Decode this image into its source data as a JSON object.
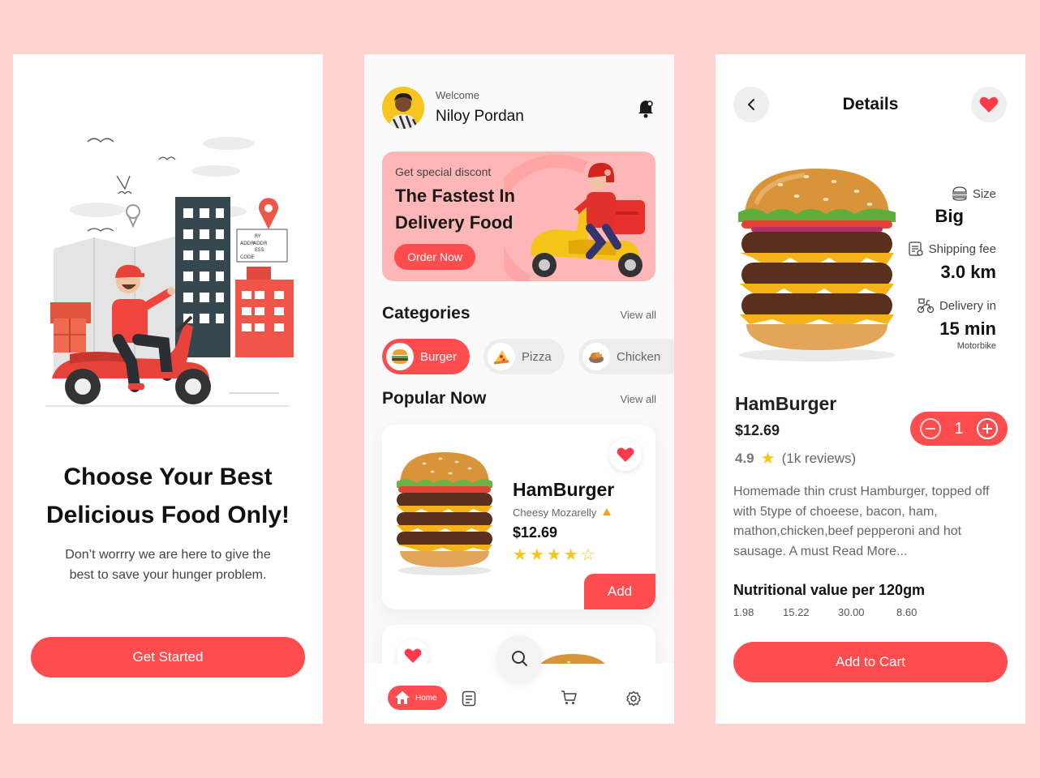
{
  "colors": {
    "background": "#FFD2D2",
    "accent": "#FF4D4F",
    "star": "#F8C51C",
    "promo": "#FFB6B6"
  },
  "onboarding": {
    "title_line1": "Choose Your Best",
    "title_line2": "Delicious Food Only!",
    "description": "Don’t worrry we are here to give the best to save your hunger problem.",
    "cta": "Get Started",
    "illustration_sign": [
      "RY",
      "ADDR",
      "ADDR",
      "ESS",
      "CODE"
    ]
  },
  "home": {
    "welcome": "Welcome",
    "user_name": "Niloy Pordan",
    "promo": {
      "subtitle": "Get special discont",
      "title_line1": "The Fastest In",
      "title_line2": "Delivery Food",
      "button": "Order Now"
    },
    "categories_title": "Categories",
    "categories_view_all": "View all",
    "categories": [
      {
        "label": "Burger",
        "icon": "burger-icon",
        "active": true
      },
      {
        "label": "Pizza",
        "icon": "pizza-icon",
        "active": false
      },
      {
        "label": "Chicken",
        "icon": "chicken-icon",
        "active": false
      }
    ],
    "popular_title": "Popular Now",
    "popular_view_all": "View all",
    "popular_item": {
      "name": "HamBurger",
      "subtitle": "Cheesy Mozarelly",
      "price": "$12.69",
      "rating_stars": 4.5,
      "add_label": "Add"
    },
    "nav": {
      "home_label": "Home"
    }
  },
  "details": {
    "title": "Details",
    "size_label": "Size",
    "size_value": "Big",
    "shipping_label": "Shipping fee",
    "shipping_value": "3.0 km",
    "delivery_label": "Delivery in",
    "delivery_value": "15 min",
    "delivery_mode": "Motorbike",
    "name": "HamBurger",
    "price": "$12.69",
    "rating": "4.9",
    "reviews": "(1k reviews)",
    "quantity": "1",
    "description": "Homemade thin crust Hamburger, topped off with 5type of choeese, bacon, ham, mathon,chicken,beef pepperoni and hot sausage. A must Read More...",
    "nutrition_title": "Nutritional value per 120gm",
    "nutrition_values": [
      "1.98",
      "15.22",
      "30.00",
      "8.60"
    ],
    "cta": "Add to Cart"
  }
}
